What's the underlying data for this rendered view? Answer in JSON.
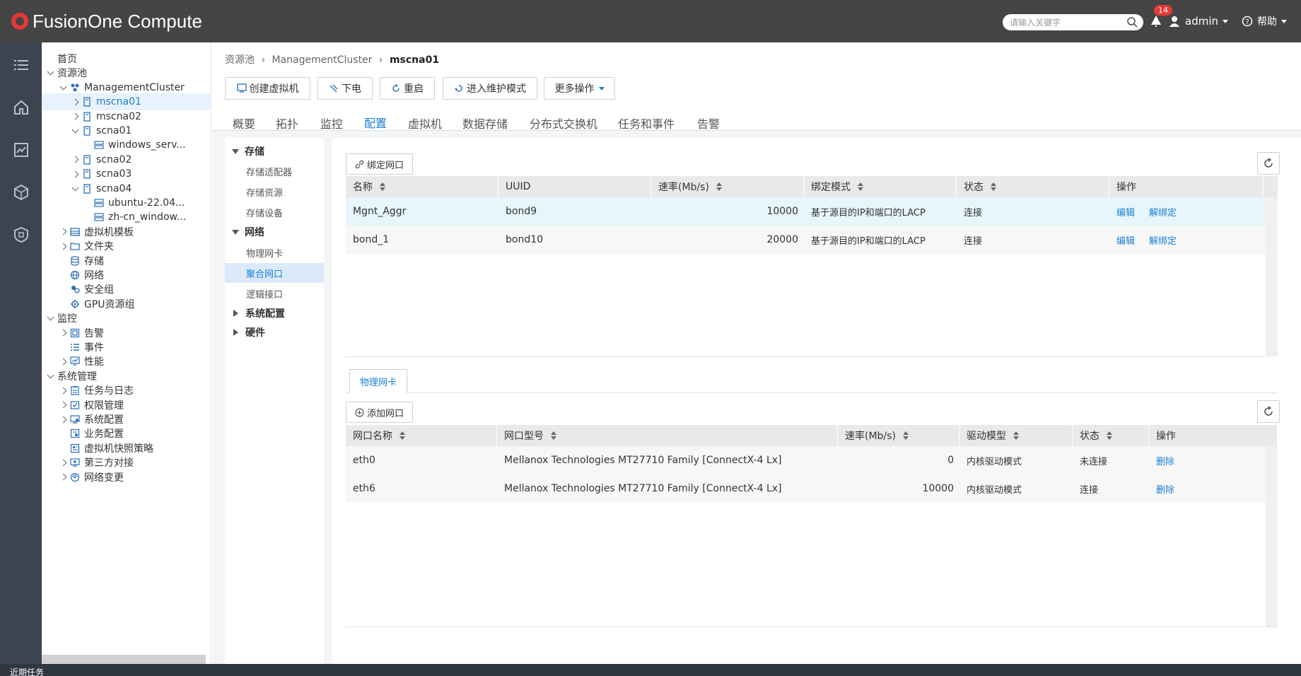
{
  "header": {
    "logo_text": "FusionOne Compute",
    "search_placeholder": "请输入关键字",
    "alarm_count": "14",
    "user": "admin",
    "help": "帮助"
  },
  "tree": [
    {
      "label": "首页",
      "level": 0,
      "arrow": "none",
      "icon": "none"
    },
    {
      "label": "资源池",
      "level": 0,
      "arrow": "down",
      "icon": "none"
    },
    {
      "label": "ManagementCluster",
      "level": 1,
      "arrow": "down",
      "icon": "cluster-icon"
    },
    {
      "label": "mscna01",
      "level": 2,
      "arrow": "right",
      "icon": "host-icon",
      "selected": true
    },
    {
      "label": "mscna02",
      "level": 2,
      "arrow": "right",
      "icon": "host-icon"
    },
    {
      "label": "scna01",
      "level": 2,
      "arrow": "down",
      "icon": "host-icon"
    },
    {
      "label": "windows_serv...",
      "level": 3,
      "arrow": "none",
      "icon": "vm-icon"
    },
    {
      "label": "scna02",
      "level": 2,
      "arrow": "right",
      "icon": "host-icon"
    },
    {
      "label": "scna03",
      "level": 2,
      "arrow": "right",
      "icon": "host-icon"
    },
    {
      "label": "scna04",
      "level": 2,
      "arrow": "down",
      "icon": "host-icon"
    },
    {
      "label": "ubuntu-22.04...",
      "level": 3,
      "arrow": "none",
      "icon": "vm-icon"
    },
    {
      "label": "zh-cn_window...",
      "level": 3,
      "arrow": "none",
      "icon": "vm-icon"
    },
    {
      "label": "虚拟机模板",
      "level": 1,
      "arrow": "right",
      "icon": "template-icon"
    },
    {
      "label": "文件夹",
      "level": 1,
      "arrow": "right",
      "icon": "folder-icon"
    },
    {
      "label": "存储",
      "level": 1,
      "arrow": "none",
      "icon": "storage-icon"
    },
    {
      "label": "网络",
      "level": 1,
      "arrow": "none",
      "icon": "network-icon"
    },
    {
      "label": "安全组",
      "level": 1,
      "arrow": "none",
      "icon": "security-group-icon"
    },
    {
      "label": "GPU资源组",
      "level": 1,
      "arrow": "none",
      "icon": "gpu-icon"
    },
    {
      "label": "监控",
      "level": 0,
      "arrow": "down",
      "icon": "none"
    },
    {
      "label": "告警",
      "level": 1,
      "arrow": "right",
      "icon": "alarm-icon"
    },
    {
      "label": "事件",
      "level": 1,
      "arrow": "none",
      "icon": "event-icon"
    },
    {
      "label": "性能",
      "level": 1,
      "arrow": "right",
      "icon": "performance-icon"
    },
    {
      "label": "系统管理",
      "level": 0,
      "arrow": "down",
      "icon": "none"
    },
    {
      "label": "任务与日志",
      "level": 1,
      "arrow": "right",
      "icon": "task-log-icon"
    },
    {
      "label": "权限管理",
      "level": 1,
      "arrow": "right",
      "icon": "permission-icon"
    },
    {
      "label": "系统配置",
      "level": 1,
      "arrow": "right",
      "icon": "system-config-icon"
    },
    {
      "label": "业务配置",
      "level": 1,
      "arrow": "none",
      "icon": "service-config-icon"
    },
    {
      "label": "虚拟机快照策略",
      "level": 1,
      "arrow": "none",
      "icon": "snapshot-policy-icon"
    },
    {
      "label": "第三方对接",
      "level": 1,
      "arrow": "right",
      "icon": "third-party-icon"
    },
    {
      "label": "网络变更",
      "level": 1,
      "arrow": "right",
      "icon": "network-change-icon"
    }
  ],
  "breadcrumb": {
    "root": "资源池",
    "cluster": "ManagementCluster",
    "current": "mscna01",
    "sep": "›"
  },
  "toolbar": {
    "create_vm": "创建虚拟机",
    "power_off": "下电",
    "restart": "重启",
    "maintenance": "进入维护模式",
    "more": "更多操作"
  },
  "tabs": [
    "概要",
    "拓扑",
    "监控",
    "配置",
    "虚拟机",
    "数据存储",
    "分布式交换机",
    "任务和事件",
    "告警"
  ],
  "active_tab": 3,
  "submenu": [
    {
      "label": "存储",
      "type": "group",
      "expanded": true
    },
    {
      "label": "存储适配器",
      "type": "item"
    },
    {
      "label": "存储资源",
      "type": "item"
    },
    {
      "label": "存储设备",
      "type": "item"
    },
    {
      "label": "网络",
      "type": "group",
      "expanded": true
    },
    {
      "label": "物理网卡",
      "type": "item"
    },
    {
      "label": "聚合网口",
      "type": "item",
      "selected": true
    },
    {
      "label": "逻辑接口",
      "type": "item"
    },
    {
      "label": "系统配置",
      "type": "group",
      "expanded": false
    },
    {
      "label": "硬件",
      "type": "group",
      "expanded": false
    }
  ],
  "bond_panel": {
    "bind_button": "绑定网口",
    "columns": [
      "名称",
      "UUID",
      "速率(Mb/s)",
      "绑定模式",
      "状态",
      "操作"
    ],
    "rows": [
      {
        "name": "Mgnt_Aggr",
        "uuid": "bond9",
        "speed": "10000",
        "mode": "基于源目的IP和端口的LACP",
        "status": "连接",
        "edit": "编辑",
        "unbind": "解绑定"
      },
      {
        "name": "bond_1",
        "uuid": "bond10",
        "speed": "20000",
        "mode": "基于源目的IP和端口的LACP",
        "status": "连接",
        "edit": "编辑",
        "unbind": "解绑定"
      }
    ]
  },
  "nic_panel": {
    "subtab": "物理网卡",
    "add_button": "添加网口",
    "columns": [
      "网口名称",
      "网口型号",
      "速率(Mb/s)",
      "驱动模型",
      "状态",
      "操作"
    ],
    "rows": [
      {
        "name": "eth0",
        "model": "Mellanox Technologies MT27710 Family [ConnectX-4 Lx]",
        "speed": "0",
        "driver": "内核驱动模式",
        "status": "未连接",
        "action": "删除"
      },
      {
        "name": "eth6",
        "model": "Mellanox Technologies MT27710 Family [ConnectX-4 Lx]",
        "speed": "10000",
        "driver": "内核驱动模式",
        "status": "连接",
        "action": "删除"
      }
    ]
  },
  "bottom_bar": "近期任务"
}
